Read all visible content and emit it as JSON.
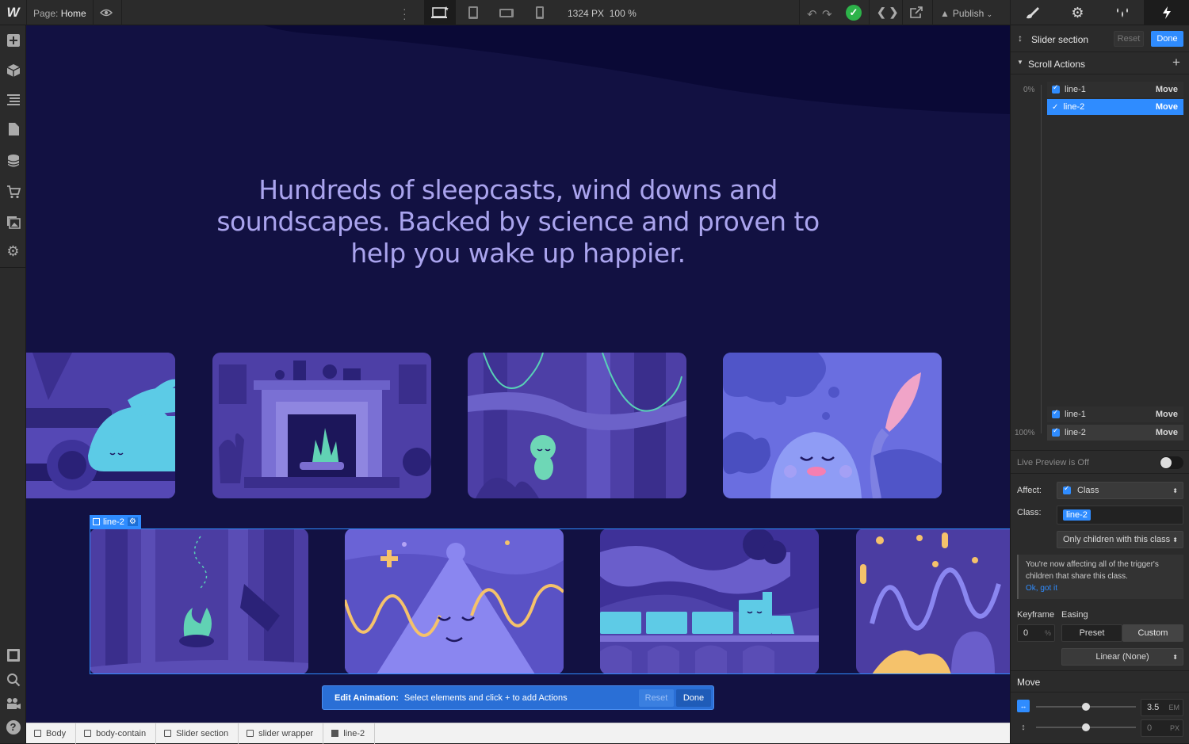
{
  "topbar": {
    "page_prefix": "Page:",
    "page_name": "Home",
    "size": "1324 PX",
    "zoom": "100 %",
    "publish_label": "Publish"
  },
  "left_toolbar": {
    "icons": [
      "add-icon",
      "components-icon",
      "navigator-icon",
      "pages-icon",
      "cms-icon",
      "ecommerce-icon",
      "assets-icon",
      "settings-icon"
    ],
    "bottom_icons": [
      "frame-icon",
      "search-icon",
      "video-icon",
      "help-icon"
    ]
  },
  "canvas": {
    "headline_lines": [
      "Hundreds of sleepcasts, wind downs and",
      "soundscapes. Backed by science and proven to",
      "help you wake up happier."
    ],
    "selection_tag": "line-2",
    "edit_bar": {
      "title": "Edit Animation:",
      "message": "Select elements and click + to add Actions",
      "reset": "Reset",
      "done": "Done"
    },
    "row1_cards": [
      "cat-illustration",
      "fireplace-illustration",
      "monkey-jungle-illustration",
      "dreaming-blob-illustration"
    ],
    "row2_cards": [
      "campfire-forest-illustration",
      "sleeping-mountain-illustration",
      "sleepy-train-illustration",
      "wavy-abstract-illustration"
    ]
  },
  "breadcrumb": [
    "Body",
    "body-contain",
    "Slider section",
    "slider wrapper",
    "line-2"
  ],
  "panel": {
    "tabs": [
      "style-tab",
      "settings-tab",
      "interactions-tab",
      "lightning-tab"
    ],
    "header_title": "Slider section",
    "reset": "Reset",
    "done": "Done",
    "section_title": "Scroll Actions",
    "start_percent": "0%",
    "end_percent": "100%",
    "start_actions": [
      {
        "target": "line-1",
        "action": "Move",
        "selected": false
      },
      {
        "target": "line-2",
        "action": "Move",
        "selected": true
      }
    ],
    "end_actions": [
      {
        "target": "line-1",
        "action": "Move"
      },
      {
        "target": "line-2",
        "action": "Move"
      }
    ],
    "live_preview": "Live Preview is Off",
    "affect_label": "Affect:",
    "affect_value": "Class",
    "class_label": "Class:",
    "class_value": "line-2",
    "children_option": "Only children with this class",
    "notice_text": "You're now affecting all of the trigger's children that share this class.",
    "notice_link": "Ok, got it",
    "keyframe_label": "Keyframe",
    "easing_label": "Easing",
    "keyframe_value": "0",
    "keyframe_unit": "%",
    "easing_preset": "Preset",
    "easing_custom": "Custom",
    "easing_value": "Linear (None)",
    "move_label": "Move",
    "move_x_value": "3.5",
    "move_x_unit": "EM",
    "move_y_value": "0",
    "move_y_unit": "PX"
  },
  "colors": {
    "accent": "#2f8cff",
    "canvas_bg": "#121142",
    "headline": "#aaa4ee"
  }
}
